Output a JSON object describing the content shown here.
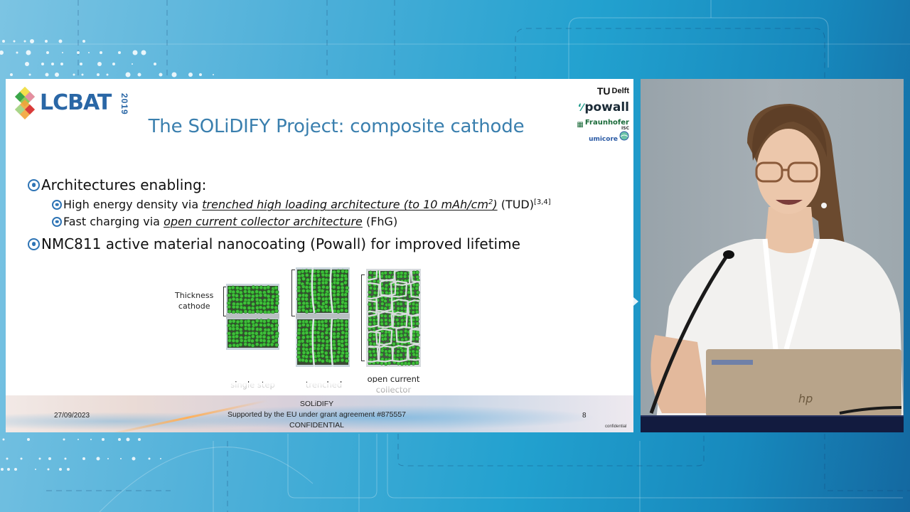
{
  "slide": {
    "logo": {
      "name": "LCBAT",
      "year": "2019",
      "mark_colors": [
        "#d93a3a",
        "#f2a43a",
        "#f4e04d",
        "#7ec44a",
        "#3aa64a",
        "#e58fa0"
      ]
    },
    "title": "The SOLiDIFY Project: composite cathode",
    "partners": [
      {
        "id": "tudelft",
        "prefix": "TU",
        "label": "Delft"
      },
      {
        "id": "powall",
        "prefix": "ʻ⁄",
        "label": "powall"
      },
      {
        "id": "fraunhofer",
        "prefix": "▦",
        "label": "Fraunhofer",
        "sub": "ISC"
      },
      {
        "id": "umicore",
        "prefix": "",
        "label": "umicore"
      }
    ],
    "bullets": [
      {
        "text": "Architectures enabling:",
        "children": [
          {
            "pre": "High energy density via ",
            "em": "trenched high loading architecture (to 10 mAh/cm",
            "em_sup": "2",
            "em_post": ")",
            "post": " (TUD)",
            "sup": "[3,4]"
          },
          {
            "pre": "Fast charging via ",
            "em": "open current collector architecture",
            "post": " (FhG)"
          }
        ]
      },
      {
        "text": "NMC811 active material nanocoating (Powall) for improved lifetime"
      }
    ],
    "figure": {
      "thickness_label": [
        "Thickness",
        "cathode"
      ],
      "panels": [
        {
          "id": "single-step",
          "caption": [
            "single step"
          ]
        },
        {
          "id": "trenched",
          "caption": [
            "trenched"
          ]
        },
        {
          "id": "open-current-collector",
          "caption": [
            "open current",
            "collector"
          ]
        }
      ],
      "particle_color": "#3fbf3a"
    },
    "footer": {
      "date": "27/09/2023",
      "center": [
        "SOLiDIFY",
        "Supported by the EU under grant agreement #875557",
        "CONFIDENTIAL"
      ],
      "page_number": "8",
      "confidential_small": "confidential"
    }
  },
  "video": {
    "description": "Speaker at podium with laptop and microphone",
    "laptop_brand": "hp"
  },
  "theme": {
    "title_color": "#3a7fae",
    "bullet_icon_color": "#2e74b5",
    "background_accent": "#22a1cf"
  }
}
